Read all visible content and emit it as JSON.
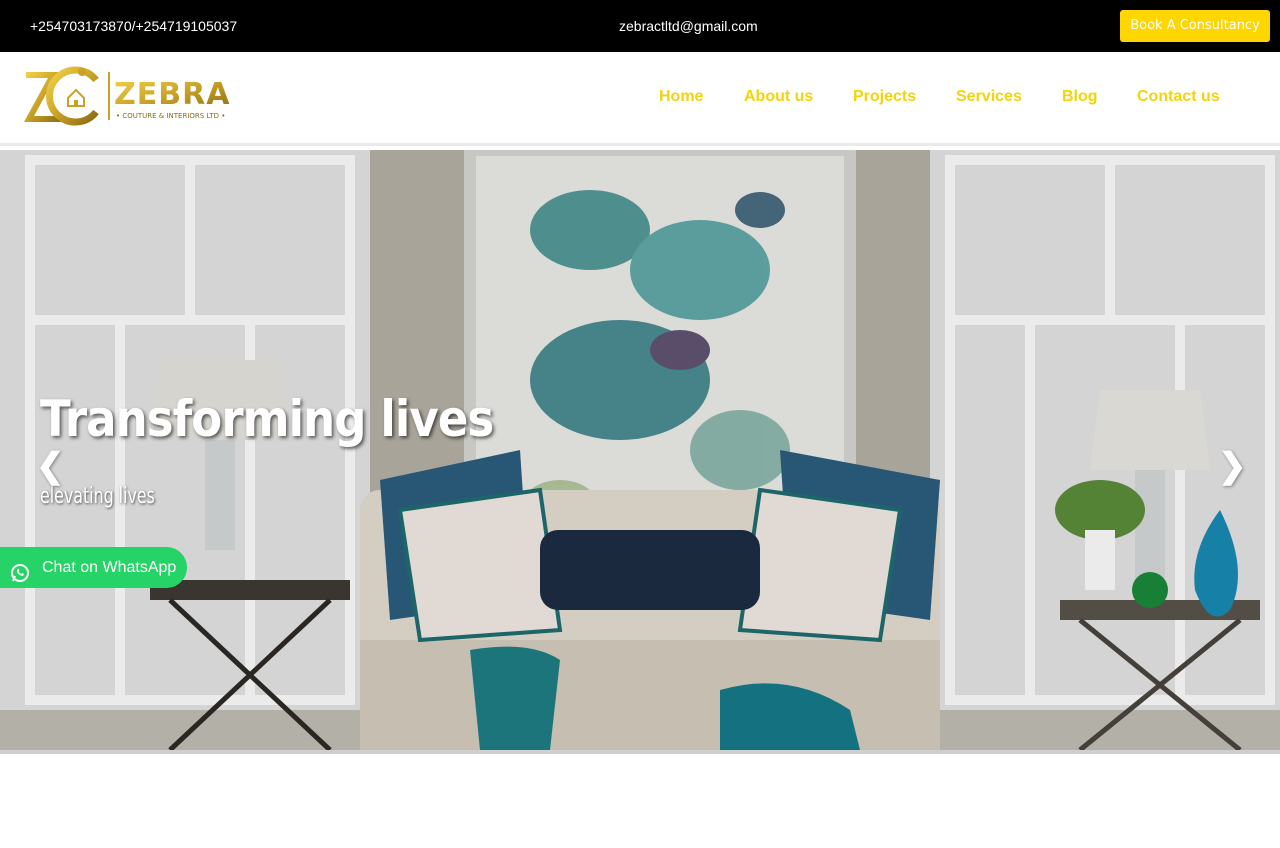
{
  "topbar": {
    "phone": "+254703173870/+254719105037",
    "email": "zebractltd@gmail.com",
    "book_label": "Book A Consultancy"
  },
  "brand": {
    "name": "ZEBRA",
    "tagline": "COUTURE & INTERIORS LTD",
    "monogram": "ZC"
  },
  "nav": {
    "items": [
      {
        "label": "Home"
      },
      {
        "label": "About us"
      },
      {
        "label": "Projects"
      },
      {
        "label": "Services"
      },
      {
        "label": "Blog"
      },
      {
        "label": "Contact us"
      }
    ]
  },
  "hero": {
    "title": "Transforming lives",
    "subtitle": "elevating lives",
    "prev_arrow": "❮",
    "next_arrow": "❯"
  },
  "whatsapp": {
    "label": "Chat on WhatsApp"
  },
  "colors": {
    "accent_yellow": "#ffd600",
    "nav_yellow": "#f5d20a",
    "topbar_bg": "#000000",
    "whatsapp_green": "#25d366",
    "logo_gold": "#c9a227"
  }
}
